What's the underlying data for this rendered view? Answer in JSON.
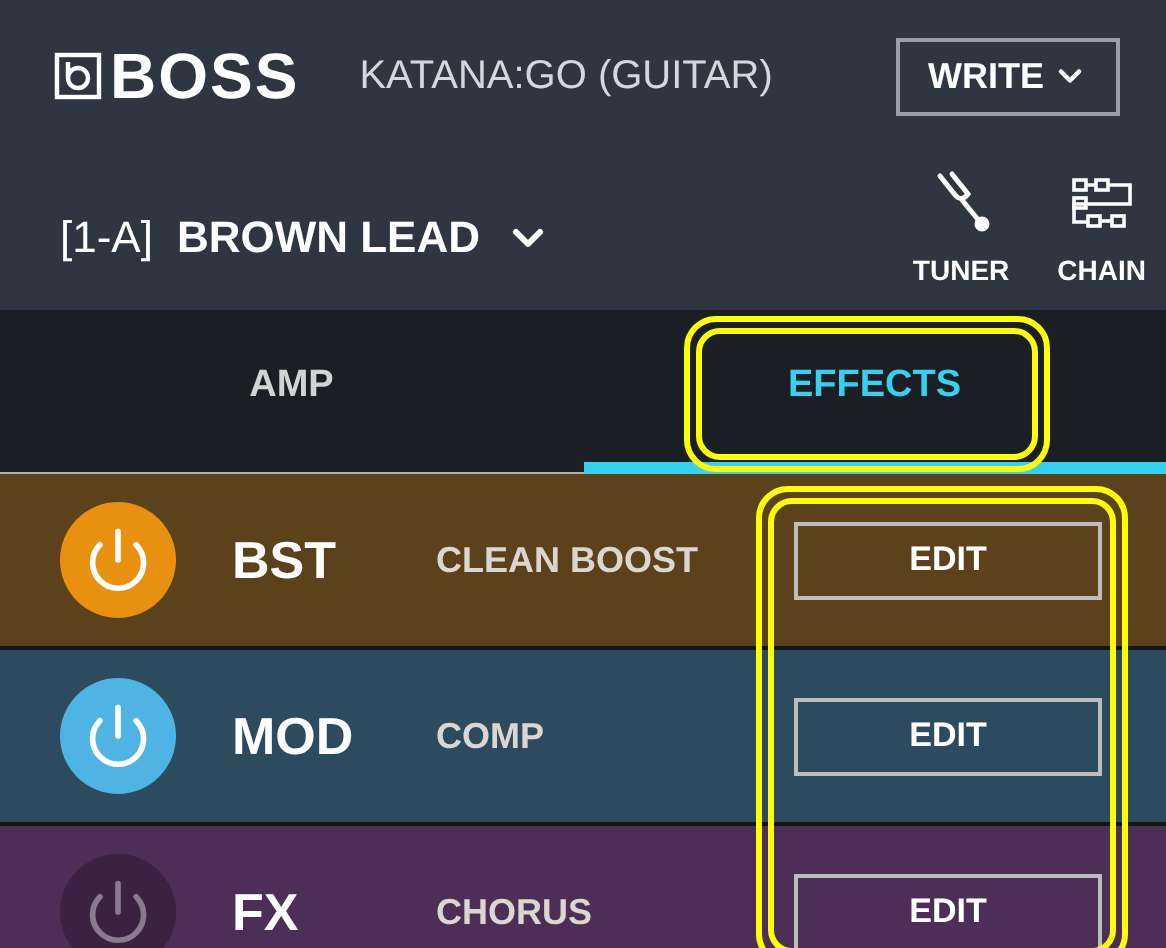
{
  "header": {
    "brand": "BOSS",
    "device": "KATANA:GO (GUITAR)",
    "write_button": "WRITE"
  },
  "preset": {
    "number": "[1-A]",
    "name": "BROWN LEAD"
  },
  "tools": [
    {
      "kind": "tuner",
      "label": "TUNER"
    },
    {
      "kind": "chain",
      "label": "CHAIN"
    }
  ],
  "tabs": [
    {
      "label": "AMP",
      "selected": false,
      "highlighted": false
    },
    {
      "label": "EFFECTS",
      "selected": true,
      "highlighted": true
    }
  ],
  "effects": {
    "edit_column_highlighted": true,
    "rows": [
      {
        "slot": "BST",
        "type": "CLEAN BOOST",
        "on": true,
        "color": "#5c421a",
        "edit": "EDIT"
      },
      {
        "slot": "MOD",
        "type": "COMP",
        "on": true,
        "color": "#2c4b5e",
        "edit": "EDIT"
      },
      {
        "slot": "FX",
        "type": "CHORUS",
        "on": false,
        "color": "#4c2e57",
        "edit": "EDIT"
      }
    ]
  }
}
